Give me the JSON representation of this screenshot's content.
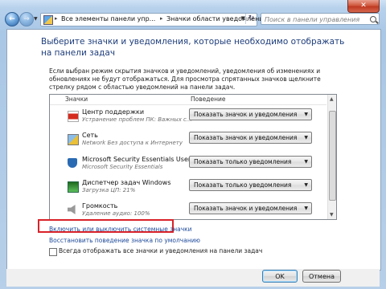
{
  "window": {
    "close_label": "✕"
  },
  "nav": {
    "back_icon": "←",
    "forward_icon": "→",
    "dropdown_icon": "▼",
    "breadcrumbs": [
      "Все элементы панели упр...",
      "Значки области уведомлений"
    ],
    "separator": "▸",
    "address_dropdown_icon": "▼",
    "refresh_icon": "↻",
    "search_placeholder": "Поиск в панели управления"
  },
  "main": {
    "heading": "Выберите значки и уведомления, которые необходимо отображать на панели задач",
    "description": "Если выбран режим скрытия значков и уведомлений, уведомления об изменениях и обновлениях не будут отображаться. Для просмотра спрятанных значков щелкните стрелку рядом с областью уведомлений на панели задач."
  },
  "list": {
    "columns": {
      "icons": "Значки",
      "behavior": "Поведение"
    },
    "rows": [
      {
        "title": "Центр поддержки",
        "subtitle": "Устранение проблем ПК: Важных с...",
        "behavior": "Показать значок и уведомления",
        "icon": "flag-icon"
      },
      {
        "title": "Сеть",
        "subtitle": "Network Без доступа к Интернету",
        "behavior": "Показать значок и уведомления",
        "icon": "network-icon"
      },
      {
        "title": "Microsoft Security Essentials User Inte...",
        "subtitle": "Microsoft Security Essentials",
        "behavior": "Показать только уведомления",
        "icon": "shield-icon"
      },
      {
        "title": "Диспетчер задач Windows",
        "subtitle": "Загрузка ЦП: 21%",
        "behavior": "Показать только уведомления",
        "icon": "task-manager-icon"
      },
      {
        "title": "Громкость",
        "subtitle": "Удаление аудио: 100%",
        "behavior": "Показать значок и уведомления",
        "icon": "speaker-icon"
      }
    ],
    "dropdown_arrow": "▼",
    "scroll_up": "▲",
    "scroll_down": "▼"
  },
  "links": {
    "system_icons": "Включить или выключить системные значки",
    "restore_defaults": "Восстановить поведение значка по умолчанию"
  },
  "checkbox": {
    "label": "Всегда отображать все значки и уведомления на панели задач"
  },
  "buttons": {
    "ok": "OK",
    "cancel": "Отмена"
  },
  "colors": {
    "highlight": "#d8232a",
    "link": "#1e4a9a",
    "heading": "#1e3d7b"
  }
}
